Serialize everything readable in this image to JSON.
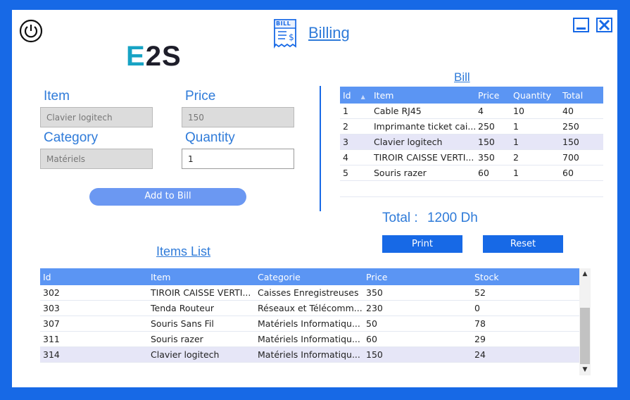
{
  "header": {
    "title": "Billing",
    "logo_prefix": "E",
    "logo_mid": "2",
    "logo_suffix": "S",
    "bill_icon_text": "BILL"
  },
  "form": {
    "item_label": "Item",
    "item_value": "Clavier logitech",
    "price_label": "Price",
    "price_value": "150",
    "category_label": "Category",
    "category_value": "Matériels",
    "quantity_label": "Quantity",
    "quantity_value": "1",
    "add_button": "Add to Bill"
  },
  "bill": {
    "title": "Bill",
    "columns": [
      "Id",
      "Item",
      "Price",
      "Quantity",
      "Total"
    ],
    "rows": [
      [
        "1",
        "Cable RJ45",
        "4",
        "10",
        "40"
      ],
      [
        "2",
        "Imprimante ticket cai...",
        "250",
        "1",
        "250"
      ],
      [
        "3",
        "Clavier logitech",
        "150",
        "1",
        "150"
      ],
      [
        "4",
        "TIROIR CAISSE VERTI...",
        "350",
        "2",
        "700"
      ],
      [
        "5",
        "Souris razer",
        "60",
        "1",
        "60"
      ]
    ],
    "selected_row": 2,
    "total_label": "Total :",
    "total_value": "1200 Dh",
    "print_button": "Print",
    "reset_button": "Reset"
  },
  "items_list": {
    "title": "Items List",
    "columns": [
      "Id",
      "Item",
      "Categorie",
      "Price",
      "Stock"
    ],
    "rows": [
      [
        "302",
        "TIROIR CAISSE VERTI...",
        "Caisses Enregistreuses",
        "350",
        "52"
      ],
      [
        "303",
        "Tenda Routeur",
        "Réseaux et Télécomm...",
        "230",
        "0"
      ],
      [
        "307",
        "Souris Sans Fil",
        "Matériels Informatiqu...",
        "50",
        "78"
      ],
      [
        "311",
        "Souris razer",
        "Matériels Informatiqu...",
        "60",
        "29"
      ],
      [
        "314",
        "Clavier logitech",
        "Matériels Informatiqu...",
        "150",
        "24"
      ]
    ],
    "selected_row": 4
  },
  "colors": {
    "accent": "#1769e6",
    "header_row": "#5b95f3",
    "selected_row": "#e6e6f7",
    "logo_teal": "#17a3c4",
    "logo_dark": "#1e1e2a"
  },
  "icons": {
    "power": "power-icon",
    "bill": "bill-icon",
    "minimize": "minimize-icon",
    "close": "close-icon",
    "sort": "sort-asc-icon",
    "scroll_up": "chevron-up-icon",
    "scroll_down": "chevron-down-icon"
  }
}
